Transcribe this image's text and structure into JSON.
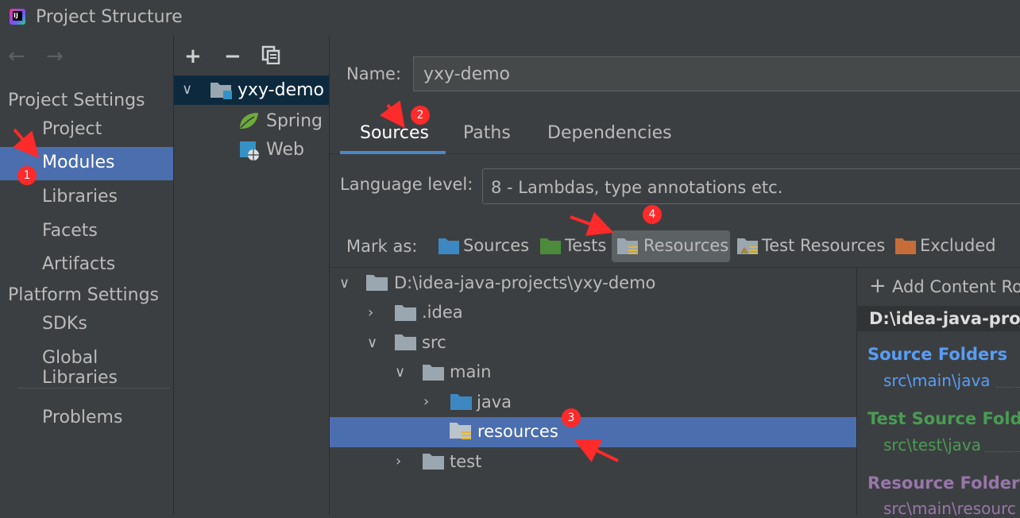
{
  "window": {
    "title": "Project Structure"
  },
  "nav": {
    "project_settings_header": "Project Settings",
    "project_settings_items": [
      "Project",
      "Modules",
      "Libraries",
      "Facets",
      "Artifacts"
    ],
    "platform_settings_header": "Platform Settings",
    "platform_settings_items": [
      "SDKs",
      "Global Libraries"
    ],
    "problems": "Problems",
    "selected": "Modules"
  },
  "modules_tree": {
    "root": "yxy-demo",
    "children": [
      "Spring",
      "Web"
    ]
  },
  "module": {
    "name_label": "Name:",
    "name_value": "yxy-demo",
    "tabs": [
      "Sources",
      "Paths",
      "Dependencies"
    ],
    "active_tab": "Sources",
    "language_level_label": "Language level:",
    "language_level_value": "8 - Lambdas, type annotations etc.",
    "mark_as_label": "Mark as:",
    "mark_as": [
      "Sources",
      "Tests",
      "Resources",
      "Test Resources",
      "Excluded"
    ]
  },
  "folder_tree": [
    {
      "label": "D:\\idea-java-projects\\yxy-demo",
      "level": 0,
      "expanded": true
    },
    {
      "label": ".idea",
      "level": 1,
      "expanded": false
    },
    {
      "label": "src",
      "level": 1,
      "expanded": true
    },
    {
      "label": "main",
      "level": 2,
      "expanded": true
    },
    {
      "label": "java",
      "level": 3,
      "expanded": false
    },
    {
      "label": "resources",
      "level": 4,
      "selected": true
    },
    {
      "label": "test",
      "level": 2,
      "expanded": false
    }
  ],
  "content_roots": {
    "add_button": "Add Content Ro",
    "root_path": "D:\\idea-java-proj",
    "source_folders_title": "Source Folders",
    "source_folders_item": "src\\main\\java",
    "test_source_title": "Test Source Folde",
    "test_source_item": "src\\test\\java",
    "resource_title": "Resource Folders",
    "resource_item": "src\\main\\resourc"
  },
  "annotations": [
    "1",
    "2",
    "3",
    "4"
  ],
  "colors": {
    "selection": "#4b6eaf",
    "sources_folder": "#3d88c2",
    "tests_folder": "#4c8b3b",
    "resources_title": "#9876aa",
    "excluded_folder": "#c76d3a",
    "annotation": "#ff2a2a"
  }
}
